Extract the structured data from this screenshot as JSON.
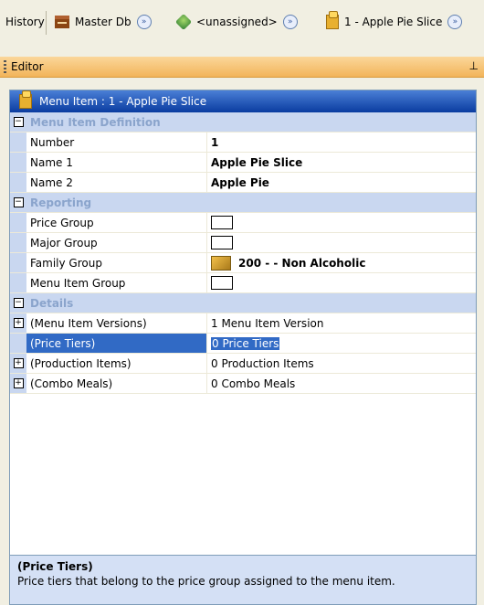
{
  "toolbar": {
    "history_label": "History",
    "items": [
      {
        "icon": "database-icon",
        "label": "Master Db"
      },
      {
        "icon": "revenue-center-icon",
        "label": "<unassigned>"
      },
      {
        "icon": "menu-item-icon",
        "label": "1 - Apple Pie Slice"
      }
    ]
  },
  "editor": {
    "title": "Editor",
    "pin": "ᵽ"
  },
  "pane": {
    "title": "Menu Item : 1 - Apple Pie Slice"
  },
  "sections": {
    "definition": {
      "label": "Menu Item Definition",
      "rows": [
        {
          "name": "Number",
          "value": "1"
        },
        {
          "name": "Name 1",
          "value": "Apple Pie Slice"
        },
        {
          "name": "Name 2",
          "value": "Apple Pie"
        }
      ]
    },
    "reporting": {
      "label": "Reporting",
      "rows": [
        {
          "name": "Price Group",
          "value": ""
        },
        {
          "name": "Major Group",
          "value": ""
        },
        {
          "name": "Family Group",
          "value": "200 - - Non Alcoholic"
        },
        {
          "name": "Menu Item Group",
          "value": ""
        }
      ]
    },
    "details": {
      "label": "Details",
      "rows": [
        {
          "name": "(Menu Item Versions)",
          "value": "1 Menu Item Version"
        },
        {
          "name": "(Price Tiers)",
          "value": "0 Price Tiers"
        },
        {
          "name": "(Production Items)",
          "value": "0 Production Items"
        },
        {
          "name": "(Combo Meals)",
          "value": "0 Combo Meals"
        }
      ]
    }
  },
  "description": {
    "title": "(Price Tiers)",
    "text": "Price tiers that belong to the price group assigned to the menu item."
  },
  "colors": {
    "accent": "#316ac5",
    "header": "#0a3ca0",
    "editor_bar": "#f2b45a"
  }
}
